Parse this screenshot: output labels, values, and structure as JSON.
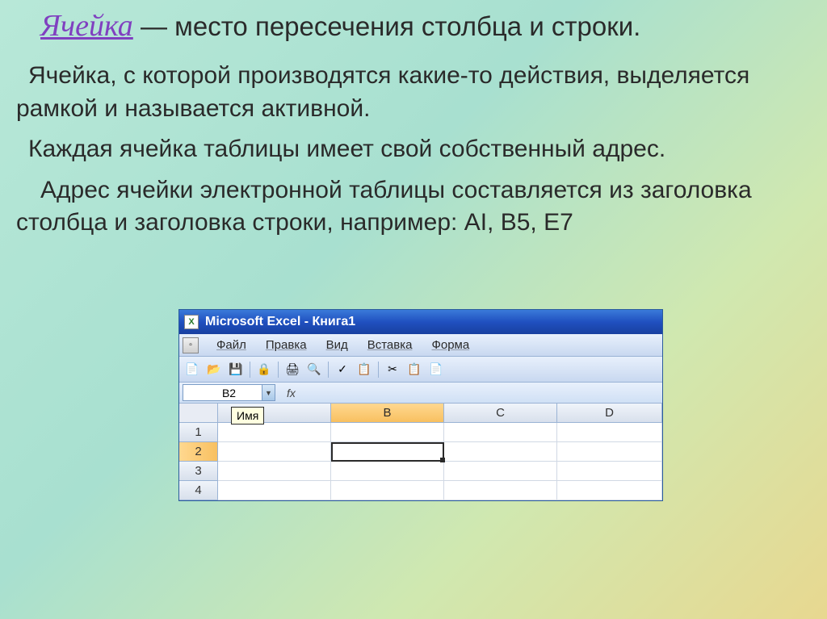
{
  "title": {
    "term": "Ячейка",
    "rest": " — место пересечения столбца и строки."
  },
  "paragraphs": {
    "p1": "Ячейка, с которой производятся какие-то действия, выделяется рамкой и называется активной.",
    "p2": "Каждая ячейка таблицы имеет свой собственный адрес.",
    "p3": "Адрес ячейки электронной таблицы составляется из заголовка столбца и заголовка строки, например: AI, B5, E7"
  },
  "excel": {
    "title": "Microsoft Excel - Книга1",
    "menu": {
      "file": "Файл",
      "edit": "Правка",
      "view": "Вид",
      "insert": "Вставка",
      "format": "Форма"
    },
    "namebox": "B2",
    "fx": "fx",
    "tooltip": "Имя",
    "columns": {
      "b": "B",
      "c": "C",
      "d": "D"
    },
    "rows": {
      "r1": "1",
      "r2": "2",
      "r3": "3",
      "r4": "4"
    }
  }
}
